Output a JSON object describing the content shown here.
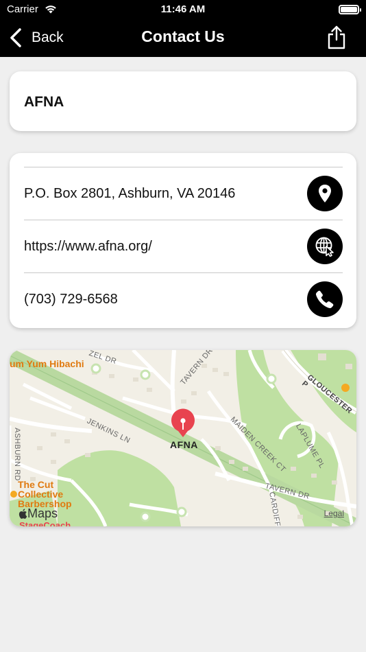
{
  "status_bar": {
    "carrier": "Carrier",
    "time": "11:46 AM"
  },
  "nav": {
    "back_label": "Back",
    "title": "Contact Us"
  },
  "organization": {
    "name": "AFNA"
  },
  "contact": {
    "address": "P.O. Box 2801, Ashburn, VA 20146",
    "website": "https://www.afna.org/",
    "phone": "(703) 729-6568"
  },
  "map": {
    "pin_label": "AFNA",
    "pois": {
      "hibachi": "um Yum Hibachi",
      "barbershop_1": "The Cut",
      "barbershop_2": "Collective",
      "barbershop_3": "Barbershop",
      "stagecoach": "StageCoach"
    },
    "streets": {
      "tavern_dr_top": "TAVERN DR",
      "hazel_dr": "ZEL DR",
      "jenkins_ln": "JENKINS LN",
      "ashburn_rd": "ASHBURN RD",
      "maiden_creek": "MAIDEN CREEK CT",
      "gloucester": "GLOUCESTER P",
      "laplume": "LAPLUME PL",
      "tavern_dr_bottom": "TAVERN DR",
      "cardiff": "CARDIFF C"
    },
    "attribution": "Maps",
    "legal": "Legal"
  },
  "colors": {
    "header_bg": "#000000",
    "page_bg": "#efefef",
    "pin": "#e8434f",
    "poi": "#e07a10",
    "park": "#b8dc9a"
  }
}
